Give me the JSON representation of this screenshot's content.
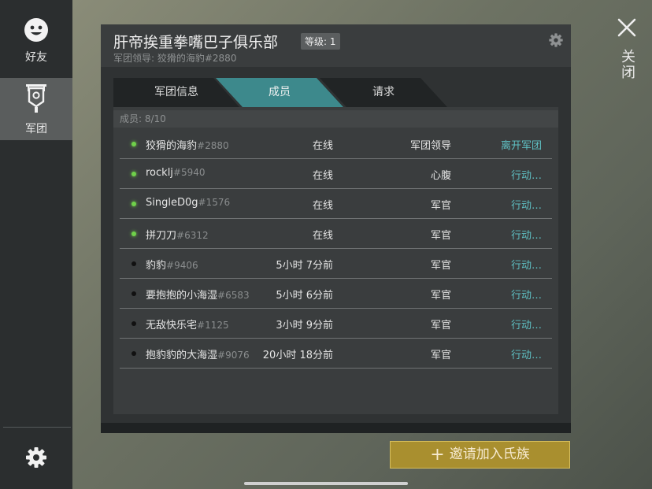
{
  "sidebar": {
    "items": [
      {
        "label": "好友",
        "icon": "smiley-icon"
      },
      {
        "label": "军团",
        "icon": "banner-icon"
      }
    ]
  },
  "close_label": "关闭",
  "clan": {
    "name": "肝帝挨重拳嘴巴子俱乐部",
    "level": "等级: 1",
    "leader_line": "军团领导: 狡猾的海豹#2880"
  },
  "tabs": [
    {
      "label": "军团信息",
      "active": false
    },
    {
      "label": "成员",
      "active": true
    },
    {
      "label": "请求",
      "active": false
    }
  ],
  "members_count": "成员: 8/10",
  "members": [
    {
      "name": "狡猾的海豹",
      "tag": "#2880",
      "status": "在线",
      "role": "军团领导",
      "action": "离开军团",
      "online": true
    },
    {
      "name": "rocklj",
      "tag": "#5940",
      "status": "在线",
      "role": "心腹",
      "action": "行动…",
      "online": true
    },
    {
      "name": "SingleD0g",
      "tag": "#1576",
      "status": "在线",
      "role": "军官",
      "action": "行动…",
      "online": true
    },
    {
      "name": "拼刀刀",
      "tag": "#6312",
      "status": "在线",
      "role": "军官",
      "action": "行动…",
      "online": true
    },
    {
      "name": "豹豹",
      "tag": "#9406",
      "status": "5小时 7分前",
      "role": "军官",
      "action": "行动…",
      "online": false
    },
    {
      "name": "要抱抱的小海湿",
      "tag": "#6583",
      "status": "5小时 6分前",
      "role": "军官",
      "action": "行动…",
      "online": false
    },
    {
      "name": "无敌快乐宅",
      "tag": "#1125",
      "status": "3小时 9分前",
      "role": "军官",
      "action": "行动…",
      "online": false
    },
    {
      "name": "抱豹豹的大海湿",
      "tag": "#9076",
      "status": "20小时 18分前",
      "role": "军官",
      "action": "行动…",
      "online": false
    }
  ],
  "invite_label": "邀请加入氏族",
  "colors": {
    "online": "#6fd14a",
    "offline": "#111111",
    "accent": "#3d898c",
    "action": "#5fc1c4",
    "invite": "#a98f2f"
  }
}
